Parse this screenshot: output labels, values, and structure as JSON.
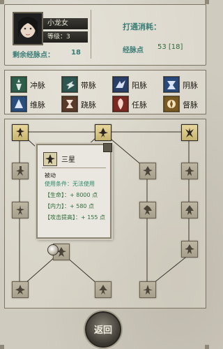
{
  "profile": {
    "name": "小龙女",
    "level": "等级：3",
    "remaining_label": "剩余经脉点：",
    "remaining_value": "18"
  },
  "cost": {
    "title": "打通消耗：",
    "label": "经脉点",
    "value": "53 [18]"
  },
  "meridians": [
    {
      "label": "冲脉",
      "icon": "meridian-chong-icon",
      "color": "#2f5f4c"
    },
    {
      "label": "带脉",
      "icon": "meridian-dai-icon",
      "color": "#2f5551"
    },
    {
      "label": "阳脉",
      "icon": "meridian-yang-icon",
      "color": "#2a3f67"
    },
    {
      "label": "阴脉",
      "icon": "meridian-yin-icon",
      "color": "#2b4a7a"
    },
    {
      "label": "维脉",
      "icon": "meridian-wei-icon",
      "color": "#2b4f7c"
    },
    {
      "label": "跷脉",
      "icon": "meridian-qiao-icon",
      "color": "#5a3b2b"
    },
    {
      "label": "任脉",
      "icon": "meridian-ren-icon",
      "color": "#7a2a22"
    },
    {
      "label": "督脉",
      "icon": "meridian-du-icon",
      "color": "#7a5a22"
    }
  ],
  "tooltip": {
    "title": "三星",
    "subtitle": "被动",
    "condition": "使用条件：无法使用",
    "lines": [
      "【生命】：+ 8000 点",
      "【内力】：+ 580 点",
      "【攻击提高】：+ 155 点"
    ]
  },
  "back_button": {
    "label": "返回"
  }
}
